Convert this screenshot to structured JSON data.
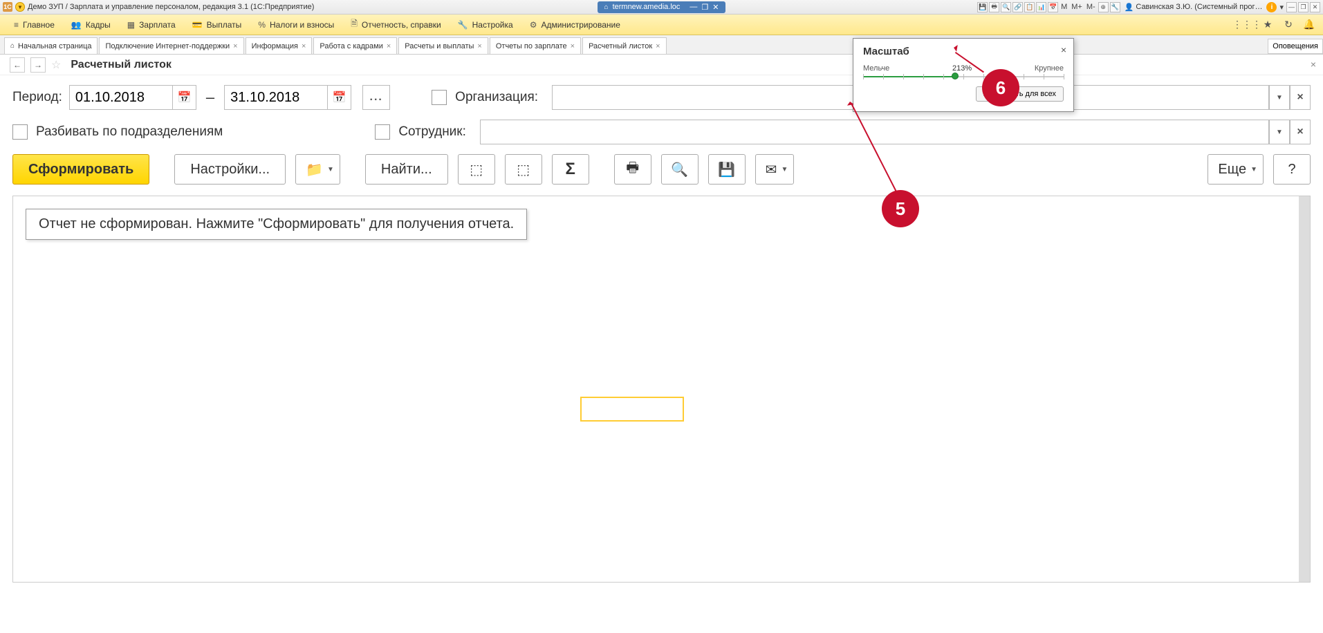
{
  "titlebar": {
    "app_title": "Демо ЗУП / Зарплата и управление персоналом, редакция 3.1  (1С:Предприятие)",
    "center_host": "termnew.amedia.loc",
    "user_name": "Савинская З.Ю. (Системный прог…",
    "m": "M",
    "mplus": "M+",
    "mminus": "M-"
  },
  "menu": {
    "items": [
      {
        "label": "Главное"
      },
      {
        "label": "Кадры"
      },
      {
        "label": "Зарплата"
      },
      {
        "label": "Выплаты"
      },
      {
        "label": "Налоги и взносы"
      },
      {
        "label": "Отчетность, справки"
      },
      {
        "label": "Настройка"
      },
      {
        "label": "Администрирование"
      }
    ]
  },
  "tabs": [
    {
      "label": "Начальная страница",
      "home": true
    },
    {
      "label": "Подключение Интернет-поддержки"
    },
    {
      "label": "Информация"
    },
    {
      "label": "Работа с кадрами"
    },
    {
      "label": "Расчеты и выплаты"
    },
    {
      "label": "Отчеты по зарплате"
    },
    {
      "label": "Расчетный листок",
      "active": true
    }
  ],
  "notif_tab": "Оповещения",
  "page": {
    "title": "Расчетный листок",
    "period_label": "Период:",
    "date_from": "01.10.2018",
    "date_to": "31.10.2018",
    "dash": "–",
    "split_label": "Разбивать по подразделениям",
    "org_label": "Организация:",
    "emp_label": "Сотрудник:",
    "dots": "..."
  },
  "toolbar": {
    "generate": "Сформировать",
    "settings": "Настройки...",
    "find": "Найти...",
    "more": "Еще",
    "help": "?"
  },
  "report": {
    "placeholder_msg": "Отчет не сформирован. Нажмите \"Сформировать\" для получения отчета."
  },
  "zoom": {
    "title": "Масштаб",
    "smaller": "Мельче",
    "bigger": "Крупнее",
    "percent": "213%",
    "set_all": "Установить для всех"
  },
  "callouts": {
    "c5": "5",
    "c6": "6"
  }
}
